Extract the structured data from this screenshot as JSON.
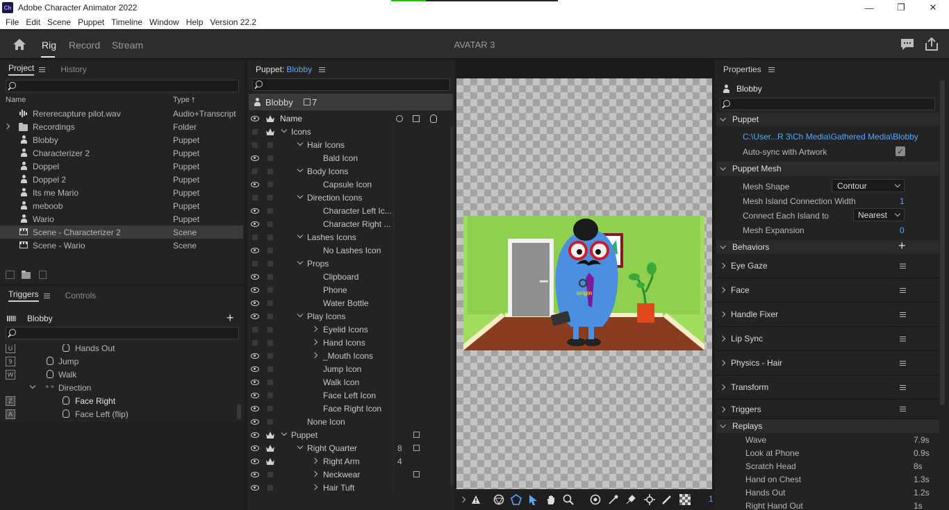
{
  "window": {
    "app_icon": "Ch",
    "title": "Adobe Character Animator 2022",
    "controls": [
      "minimize-icon",
      "restore-icon",
      "close-icon"
    ]
  },
  "menu": [
    "File",
    "Edit",
    "Scene",
    "Puppet",
    "Timeline",
    "Window",
    "Help",
    "Version 22.2"
  ],
  "workspace": {
    "tabs": [
      "Rig",
      "Record",
      "Stream"
    ],
    "active_tab": "Rig",
    "title": "AVATAR 3"
  },
  "project_panel": {
    "tabs": [
      "Project",
      "History"
    ],
    "columns": {
      "name": "Name",
      "type": "Type"
    },
    "items": [
      {
        "name": "Rererecapture pilot.wav",
        "type": "Audio+Transcript",
        "icon": "audio-icon"
      },
      {
        "name": "Recordings",
        "type": "Folder",
        "icon": "folder-icon"
      },
      {
        "name": "Blobby",
        "type": "Puppet",
        "icon": "puppet-icon"
      },
      {
        "name": "Characterizer 2",
        "type": "Puppet",
        "icon": "puppet-icon"
      },
      {
        "name": "Doppel",
        "type": "Puppet",
        "icon": "puppet-icon"
      },
      {
        "name": "Doppel 2",
        "type": "Puppet",
        "icon": "puppet-icon"
      },
      {
        "name": "Its me Mario",
        "type": "Puppet",
        "icon": "puppet-icon"
      },
      {
        "name": "meboob",
        "type": "Puppet",
        "icon": "puppet-icon"
      },
      {
        "name": "Wario",
        "type": "Puppet",
        "icon": "puppet-icon"
      },
      {
        "name": "Scene - Characterizer 2",
        "type": "Scene",
        "icon": "scene-icon",
        "selected": true
      },
      {
        "name": "Scene - Wario",
        "type": "Scene",
        "icon": "scene-icon"
      }
    ]
  },
  "triggers_panel": {
    "tabs": [
      "Triggers",
      "Controls"
    ],
    "puppet": "Blobby",
    "items": [
      {
        "key": "U",
        "label": "Hands Out"
      },
      {
        "key": "9",
        "label": "Jump"
      },
      {
        "key": "W",
        "label": "Walk"
      },
      {
        "key": "",
        "label": "Direction"
      },
      {
        "key": "Z",
        "label": "Face Right"
      },
      {
        "key": "A",
        "label": "Face Left (flip)"
      }
    ]
  },
  "puppet_panel": {
    "label": "Puppet:",
    "puppet": "Blobby",
    "header_name": "Blobby",
    "header_count": "7",
    "column_name": "Name",
    "rows": [
      {
        "name": "Icons",
        "depth": 0,
        "twirl": "open",
        "eye": false,
        "crown": true,
        "num": "",
        "tag": false
      },
      {
        "name": "Hair Icons",
        "depth": 1,
        "twirl": "open",
        "eye": false,
        "crown": false,
        "num": "",
        "tag": false
      },
      {
        "name": "Bald Icon",
        "depth": 2,
        "twirl": "",
        "eye": true,
        "crown": false,
        "num": "",
        "tag": false
      },
      {
        "name": "Body Icons",
        "depth": 1,
        "twirl": "open",
        "eye": false,
        "crown": false,
        "num": "",
        "tag": false
      },
      {
        "name": "Capsule Icon",
        "depth": 2,
        "twirl": "",
        "eye": true,
        "crown": false,
        "num": "",
        "tag": false
      },
      {
        "name": "Direction Icons",
        "depth": 1,
        "twirl": "open",
        "eye": false,
        "crown": false,
        "num": "",
        "tag": false
      },
      {
        "name": "Character Left Ic...",
        "depth": 2,
        "twirl": "",
        "eye": true,
        "crown": false,
        "num": "",
        "tag": false
      },
      {
        "name": "Character Right ...",
        "depth": 2,
        "twirl": "",
        "eye": true,
        "crown": false,
        "num": "",
        "tag": false
      },
      {
        "name": "Lashes Icons",
        "depth": 1,
        "twirl": "open",
        "eye": false,
        "crown": false,
        "num": "",
        "tag": false
      },
      {
        "name": "No Lashes Icon",
        "depth": 2,
        "twirl": "",
        "eye": true,
        "crown": false,
        "num": "",
        "tag": false
      },
      {
        "name": "Props",
        "depth": 1,
        "twirl": "open",
        "eye": false,
        "crown": false,
        "num": "",
        "tag": false
      },
      {
        "name": "Clipboard",
        "depth": 2,
        "twirl": "",
        "eye": true,
        "crown": false,
        "num": "",
        "tag": false
      },
      {
        "name": "Phone",
        "depth": 2,
        "twirl": "",
        "eye": true,
        "crown": false,
        "num": "",
        "tag": false
      },
      {
        "name": "Water Bottle",
        "depth": 2,
        "twirl": "",
        "eye": true,
        "crown": false,
        "num": "",
        "tag": false
      },
      {
        "name": "Play Icons",
        "depth": 1,
        "twirl": "open",
        "eye": true,
        "crown": false,
        "num": "",
        "tag": false
      },
      {
        "name": "Eyelid Icons",
        "depth": 2,
        "twirl": "closed",
        "eye": false,
        "crown": false,
        "num": "",
        "tag": false
      },
      {
        "name": "Hand Icons",
        "depth": 2,
        "twirl": "closed",
        "eye": false,
        "crown": false,
        "num": "",
        "tag": false
      },
      {
        "name": "_Mouth Icons",
        "depth": 2,
        "twirl": "closed",
        "eye": true,
        "crown": false,
        "num": "",
        "tag": false
      },
      {
        "name": "Jump Icon",
        "depth": 2,
        "twirl": "",
        "eye": true,
        "crown": false,
        "num": "",
        "tag": false
      },
      {
        "name": "Walk Icon",
        "depth": 2,
        "twirl": "",
        "eye": true,
        "crown": false,
        "num": "",
        "tag": false
      },
      {
        "name": "Face Left Icon",
        "depth": 2,
        "twirl": "",
        "eye": true,
        "crown": false,
        "num": "",
        "tag": false
      },
      {
        "name": "Face Right Icon",
        "depth": 2,
        "twirl": "",
        "eye": true,
        "crown": false,
        "num": "",
        "tag": false
      },
      {
        "name": "None Icon",
        "depth": 1,
        "twirl": "",
        "eye": true,
        "crown": false,
        "num": "",
        "tag": false
      },
      {
        "name": "Puppet",
        "depth": 0,
        "twirl": "open",
        "eye": true,
        "crown": true,
        "num": "",
        "tag": true
      },
      {
        "name": "Right Quarter",
        "depth": 1,
        "twirl": "open",
        "eye": true,
        "crown": true,
        "num": "8",
        "tag": true
      },
      {
        "name": "Right Arm",
        "depth": 2,
        "twirl": "closed",
        "eye": true,
        "crown": true,
        "num": "4",
        "tag": false
      },
      {
        "name": "Neckwear",
        "depth": 2,
        "twirl": "closed",
        "eye": true,
        "crown": false,
        "num": "",
        "tag": true
      },
      {
        "name": "Hair Tuft",
        "depth": 2,
        "twirl": "closed",
        "eye": true,
        "crown": false,
        "num": "",
        "tag": false
      }
    ]
  },
  "canvas": {
    "origin_label": "origin",
    "tools": [
      "chevron-right-icon",
      "warning-icon",
      "mesh-icon",
      "polygon-icon",
      "select-arrow-icon",
      "hand-icon",
      "zoom-icon",
      "origin-icon",
      "pin-icon",
      "handle-icon",
      "transform-icon",
      "stick-icon",
      "checkerboard-icon"
    ],
    "zoom_fragment": "1"
  },
  "properties_panel": {
    "title": "Properties",
    "puppet": "Blobby",
    "sections": {
      "puppet": "Puppet",
      "puppet_mesh": "Puppet Mesh",
      "behaviors": "Behaviors",
      "replays": "Replays"
    },
    "path": "C:\\User...R 3\\Ch Media\\Gathered Media\\Blobby",
    "auto_sync_label": "Auto-sync with Artwork",
    "auto_sync": true,
    "mesh_shape_label": "Mesh Shape",
    "mesh_shape": "Contour",
    "mesh_island_label": "Mesh Island Connection Width",
    "mesh_island": "1",
    "connect_label": "Connect Each Island to",
    "connect": "Nearest",
    "expansion_label": "Mesh Expansion",
    "expansion": "0",
    "behaviors": [
      "Eye Gaze",
      "Face",
      "Handle Fixer",
      "Lip Sync",
      "Physics - Hair",
      "Transform",
      "Triggers"
    ],
    "replays": [
      {
        "name": "Wave",
        "duration": "7.9s"
      },
      {
        "name": "Look at Phone",
        "duration": "0.9s"
      },
      {
        "name": "Scratch Head",
        "duration": "8s"
      },
      {
        "name": "Hand on Chest",
        "duration": "1.3s"
      },
      {
        "name": "Hands Out",
        "duration": "1.2s"
      },
      {
        "name": "Right Hand Out",
        "duration": "1s"
      }
    ]
  },
  "colors": {
    "accent": "#58a6ff",
    "panel": "#232323",
    "background": "#1d1d1d"
  }
}
